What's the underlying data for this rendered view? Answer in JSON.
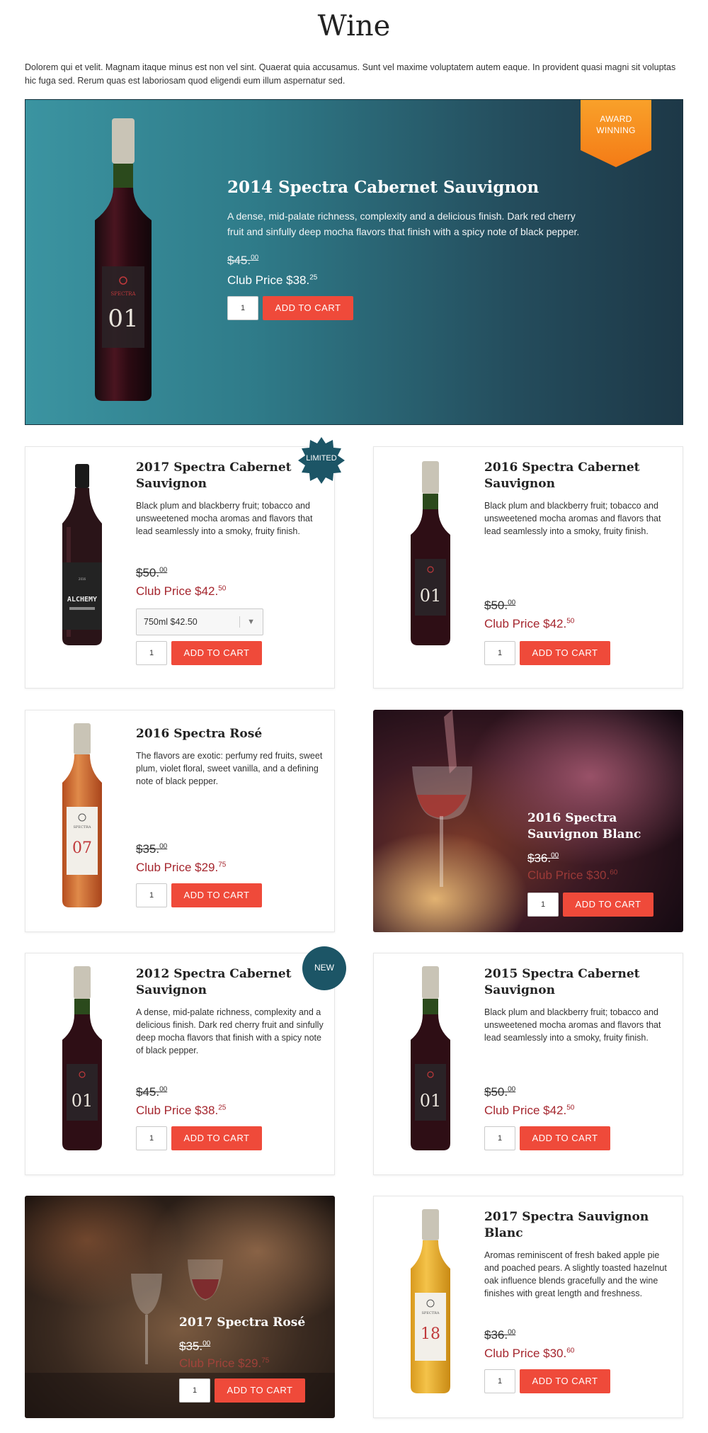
{
  "page": {
    "title": "Wine",
    "intro": "Dolorem qui et velit. Magnam itaque minus est non vel sint. Quaerat quia accusamus. Sunt vel maxime voluptatem autem eaque. In provident quasi magni sit voluptas hic fuga sed. Rerum quas est laboriosam quod eligendi eum illum aspernatur sed."
  },
  "colors": {
    "accent_button": "#ef4a3a",
    "club_price": "#a5262e",
    "hero_gradient_start": "#3b94a1",
    "hero_gradient_end": "#1d3847",
    "badge_teal": "#1c5566",
    "award_orange": "#f7931e"
  },
  "add_to_cart_label": "ADD TO CART",
  "hero": {
    "badge_line1": "AWARD",
    "badge_line2": "WINNING",
    "name": "2014 Spectra Cabernet Sauvignon",
    "description": "A dense, mid-palate richness, complexity and a delicious finish. Dark red cherry fruit and sinfully deep mocha flavors that finish with a spicy note of black pepper.",
    "old_price": "$45.",
    "old_price_cents": "00",
    "club_price": "Club Price $38.",
    "club_price_cents": "25",
    "qty": "1",
    "bottle_brand": "SPECTRA",
    "bottle_number": "01"
  },
  "products": [
    {
      "badge": "LIMITED",
      "name": "2017 Spectra Cabernet Sauvignon",
      "description": "Black plum and blackberry fruit; tobacco and unsweetened mocha aromas and flavors that lead seamlessly into a smoky, fruity finish.",
      "old_price": "$50.",
      "old_price_cents": "00",
      "club_price": "Club Price $42.",
      "club_price_cents": "50",
      "size_option": "750ml $42.50",
      "qty": "1",
      "bottle_label": "ALCHEMY"
    },
    {
      "name": "2016 Spectra Cabernet Sauvignon",
      "description": "Black plum and blackberry fruit; tobacco and unsweetened mocha aromas and flavors that lead seamlessly into a smoky, fruity finish.",
      "old_price": "$50.",
      "old_price_cents": "00",
      "club_price": "Club Price $42.",
      "club_price_cents": "50",
      "qty": "1",
      "bottle_number": "01"
    },
    {
      "name": "2016 Spectra Rosé",
      "description": "The flavors are exotic: perfumy red fruits, sweet plum, violet floral, sweet vanilla, and a defining note of black pepper.",
      "old_price": "$35.",
      "old_price_cents": "00",
      "club_price": "Club Price $29.",
      "club_price_cents": "75",
      "qty": "1",
      "bottle_brand": "SPECTRA",
      "bottle_number": "07"
    },
    {
      "name": "2016 Spectra Sauvignon Blanc",
      "old_price": "$36.",
      "old_price_cents": "00",
      "club_price": "Club Price $30.",
      "club_price_cents": "60",
      "qty": "1"
    },
    {
      "badge": "NEW",
      "name": "2012 Spectra Cabernet Sauvignon",
      "description": "A dense, mid-palate richness, complexity and a delicious finish. Dark red cherry fruit and sinfully deep mocha flavors that finish with a spicy note of black pepper.",
      "old_price": "$45.",
      "old_price_cents": "00",
      "club_price": "Club Price $38.",
      "club_price_cents": "25",
      "qty": "1",
      "bottle_number": "01"
    },
    {
      "name": "2015 Spectra Cabernet Sauvignon",
      "description": "Black plum and blackberry fruit; tobacco and unsweetened mocha aromas and flavors that lead seamlessly into a smoky, fruity finish.",
      "old_price": "$50.",
      "old_price_cents": "00",
      "club_price": "Club Price $42.",
      "club_price_cents": "50",
      "qty": "1",
      "bottle_number": "01"
    },
    {
      "name": "2017 Spectra Rosé",
      "old_price": "$35.",
      "old_price_cents": "00",
      "club_price": "Club Price $29.",
      "club_price_cents": "75",
      "qty": "1"
    },
    {
      "name": "2017 Spectra Sauvignon Blanc",
      "description": "Aromas reminiscent of fresh baked apple pie and poached pears. A slightly toasted hazelnut oak influence blends gracefully and the wine finishes with great length and freshness.",
      "old_price": "$36.",
      "old_price_cents": "00",
      "club_price": "Club Price $30.",
      "club_price_cents": "60",
      "qty": "1",
      "bottle_brand": "SPECTRA",
      "bottle_number": "18"
    }
  ]
}
